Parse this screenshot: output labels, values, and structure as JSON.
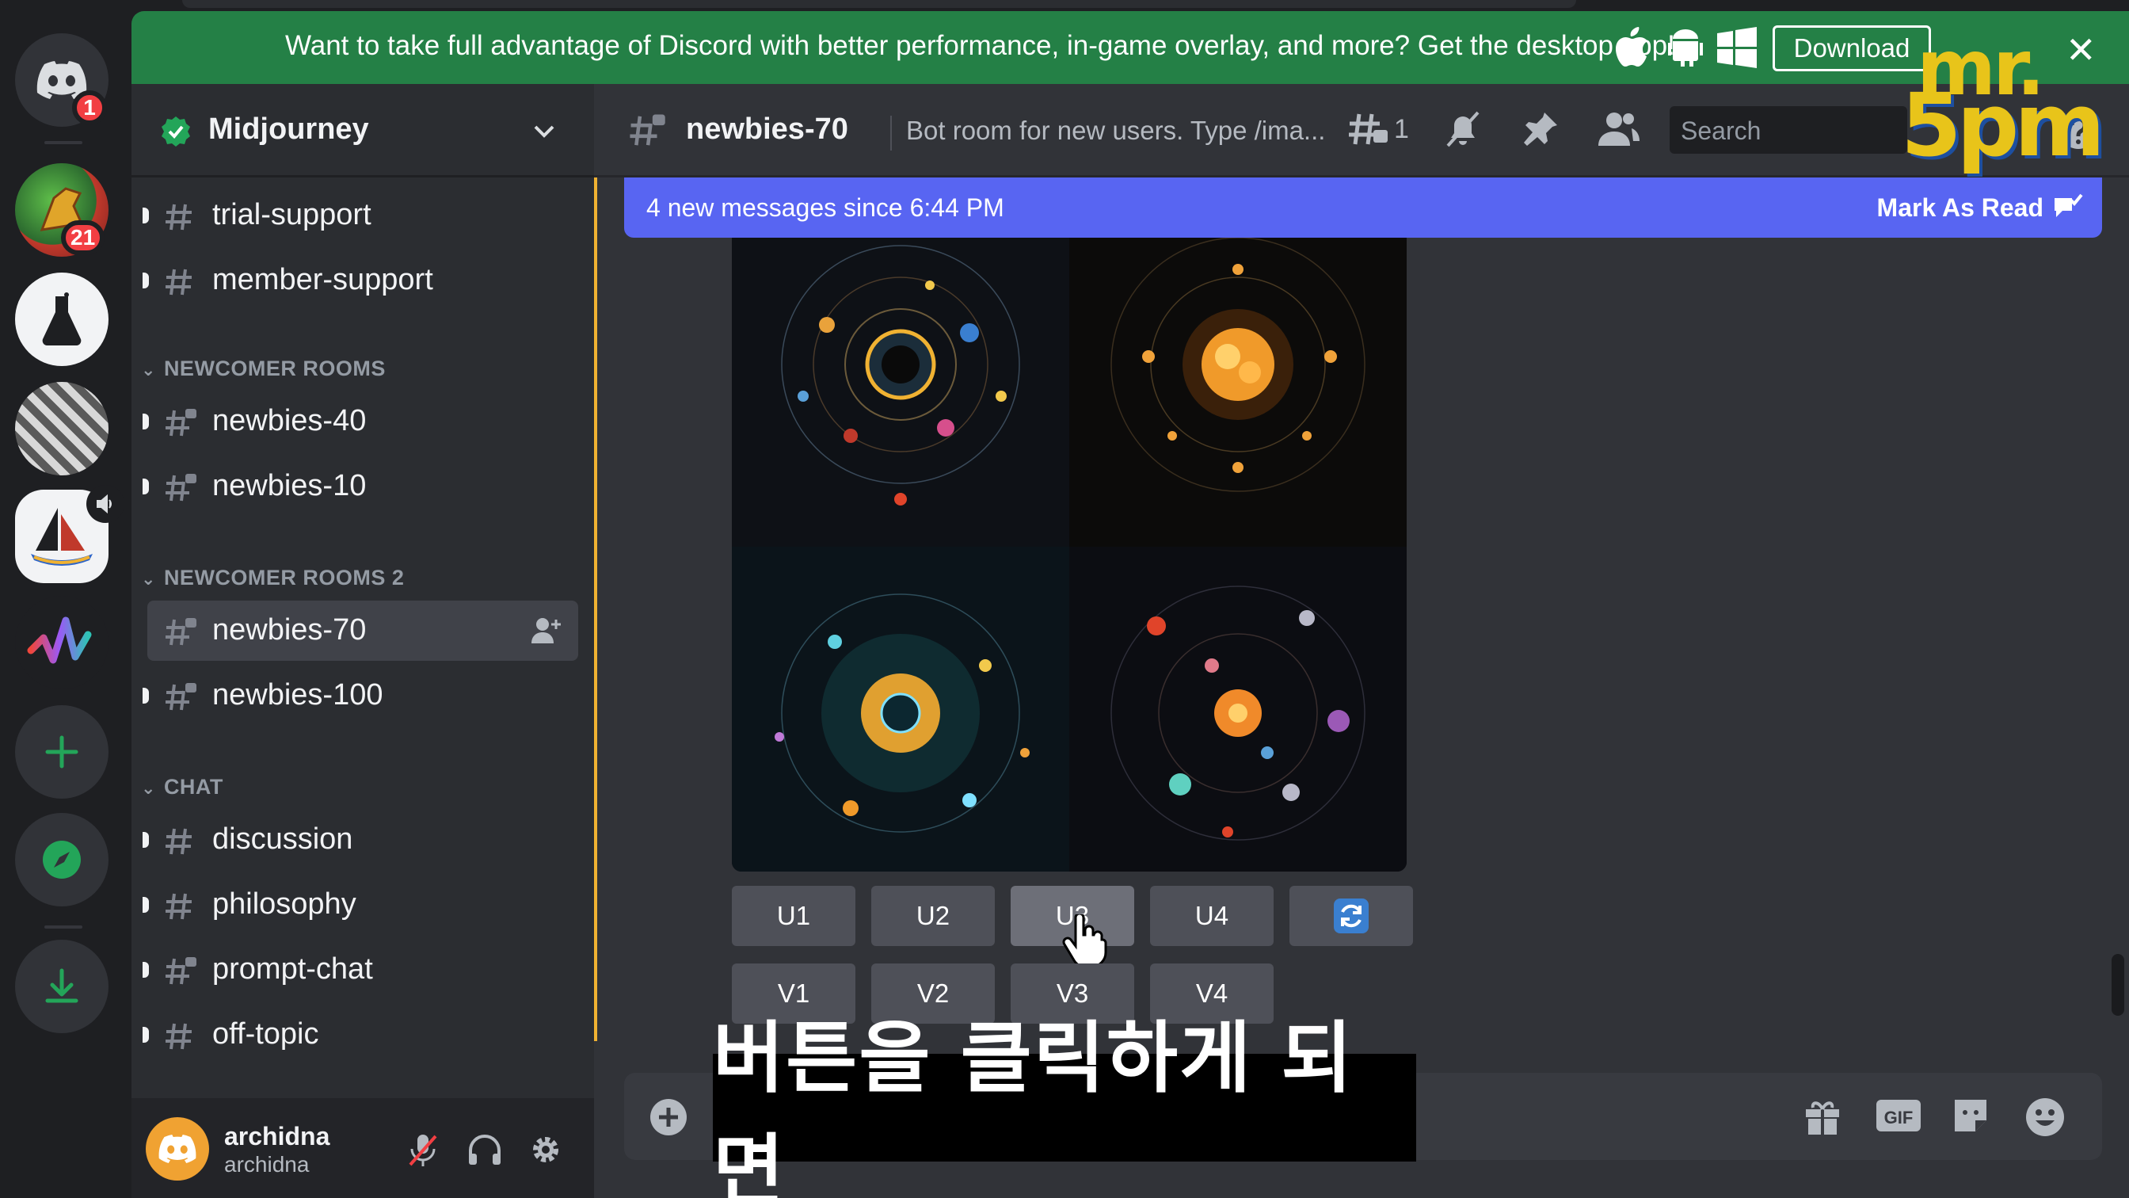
{
  "banner": {
    "message": "Want to take full advantage of Discord with better performance, in-game overlay, and more? Get the desktop app!",
    "download_label": "Download"
  },
  "server_rail": {
    "dm_badge": "1",
    "server_badge": "21"
  },
  "guild": {
    "name": "Midjourney"
  },
  "channels": {
    "top": [
      {
        "name": "trial-support"
      },
      {
        "name": "member-support"
      }
    ],
    "categories": [
      {
        "label": "NEWCOMER ROOMS",
        "items": [
          {
            "name": "newbies-40"
          },
          {
            "name": "newbies-10"
          }
        ]
      },
      {
        "label": "NEWCOMER ROOMS 2",
        "items": [
          {
            "name": "newbies-70"
          },
          {
            "name": "newbies-100"
          }
        ]
      },
      {
        "label": "CHAT",
        "items": [
          {
            "name": "discussion"
          },
          {
            "name": "philosophy"
          },
          {
            "name": "prompt-chat"
          },
          {
            "name": "off-topic"
          }
        ]
      }
    ]
  },
  "user": {
    "name": "archidna",
    "tag": "archidna"
  },
  "channel_header": {
    "name": "newbies-70",
    "topic": "Bot room for new users. Type /ima...",
    "thread_count": "1",
    "search_placeholder": "Search"
  },
  "notice": {
    "new_messages": "4 new messages since 6:44 PM",
    "mark_as_read": "Mark As Read"
  },
  "midjourney_buttons": {
    "upscale": [
      "U1",
      "U2",
      "U3",
      "U4"
    ],
    "variation": [
      "V1",
      "V2",
      "V3",
      "V4"
    ],
    "hovered": "U3"
  },
  "watermark": {
    "line1": "mr.",
    "line2": "5pm"
  },
  "subtitle": "버튼을 클릭하게 되면",
  "colors": {
    "blurple": "#5865f2",
    "banner_green": "#248046",
    "unread_line": "#f0b232"
  }
}
